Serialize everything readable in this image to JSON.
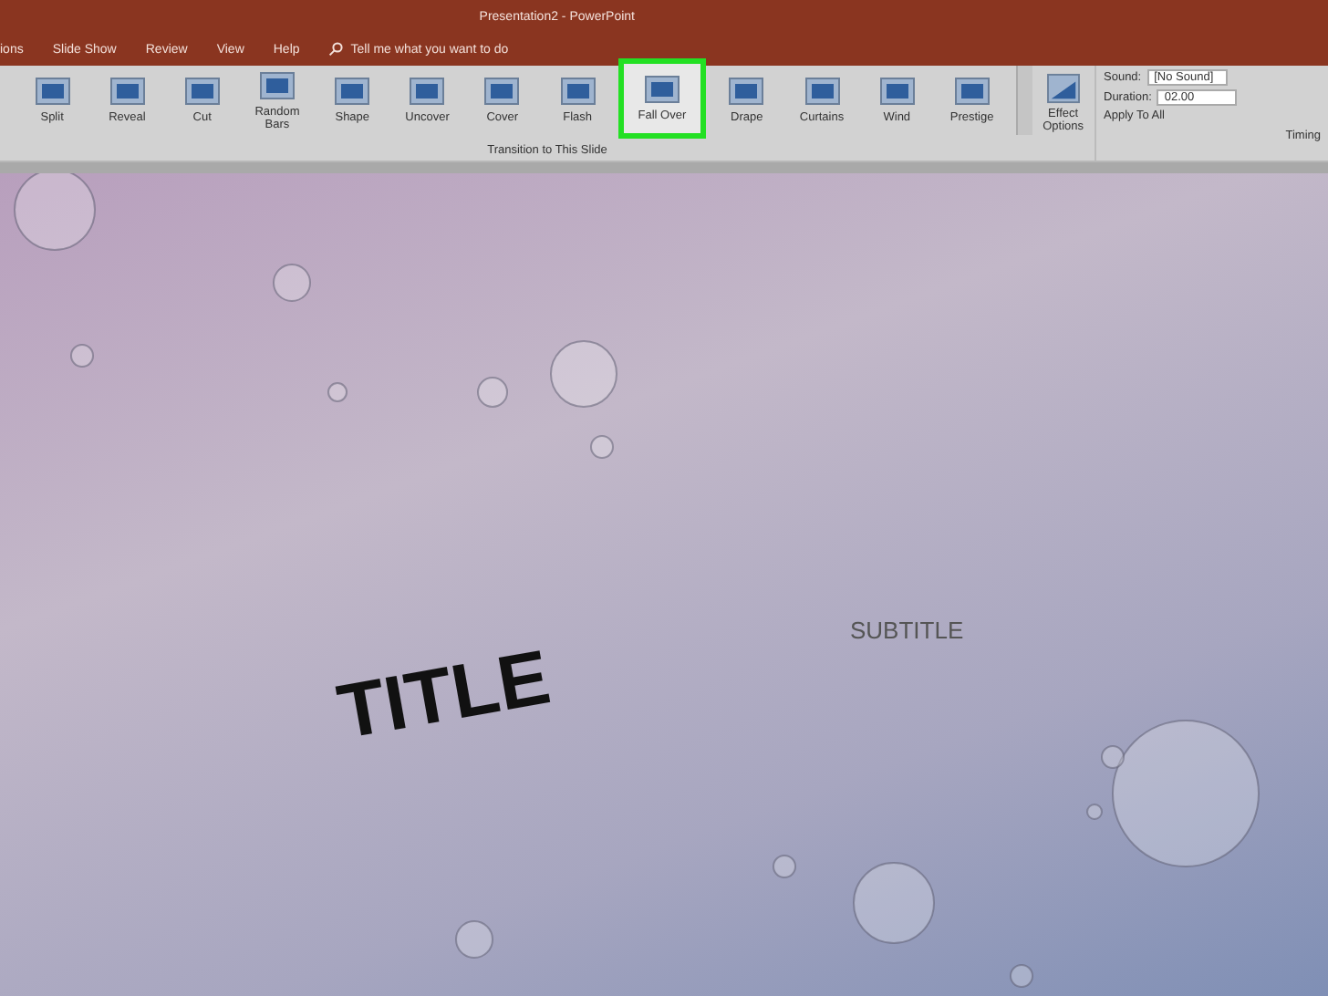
{
  "window": {
    "title": "Presentation2 - PowerPoint"
  },
  "menu_tabs": [
    "ions",
    "Slide Show",
    "Review",
    "View",
    "Help"
  ],
  "search": {
    "placeholder": "Tell me what you want to do"
  },
  "transitions": [
    {
      "label": "Split",
      "selected": false
    },
    {
      "label": "Reveal",
      "selected": false
    },
    {
      "label": "Cut",
      "selected": false
    },
    {
      "label": "Random Bars",
      "selected": false
    },
    {
      "label": "Shape",
      "selected": false
    },
    {
      "label": "Uncover",
      "selected": false
    },
    {
      "label": "Cover",
      "selected": false
    },
    {
      "label": "Flash",
      "selected": false
    },
    {
      "label": "Fall Over",
      "selected": true
    },
    {
      "label": "Drape",
      "selected": false
    },
    {
      "label": "Curtains",
      "selected": false
    },
    {
      "label": "Wind",
      "selected": false
    },
    {
      "label": "Prestige",
      "selected": false
    }
  ],
  "effect_options": {
    "label": "Effect Options"
  },
  "transition_group_label": "Transition to This Slide",
  "timing": {
    "sound_label": "Sound:",
    "sound_value": "[No Sound]",
    "duration_label": "Duration:",
    "duration_value": "02.00",
    "apply_all": "Apply To All",
    "group_label": "Timing"
  },
  "slide": {
    "title": "TITLE",
    "subtitle": "SUBTITLE"
  }
}
